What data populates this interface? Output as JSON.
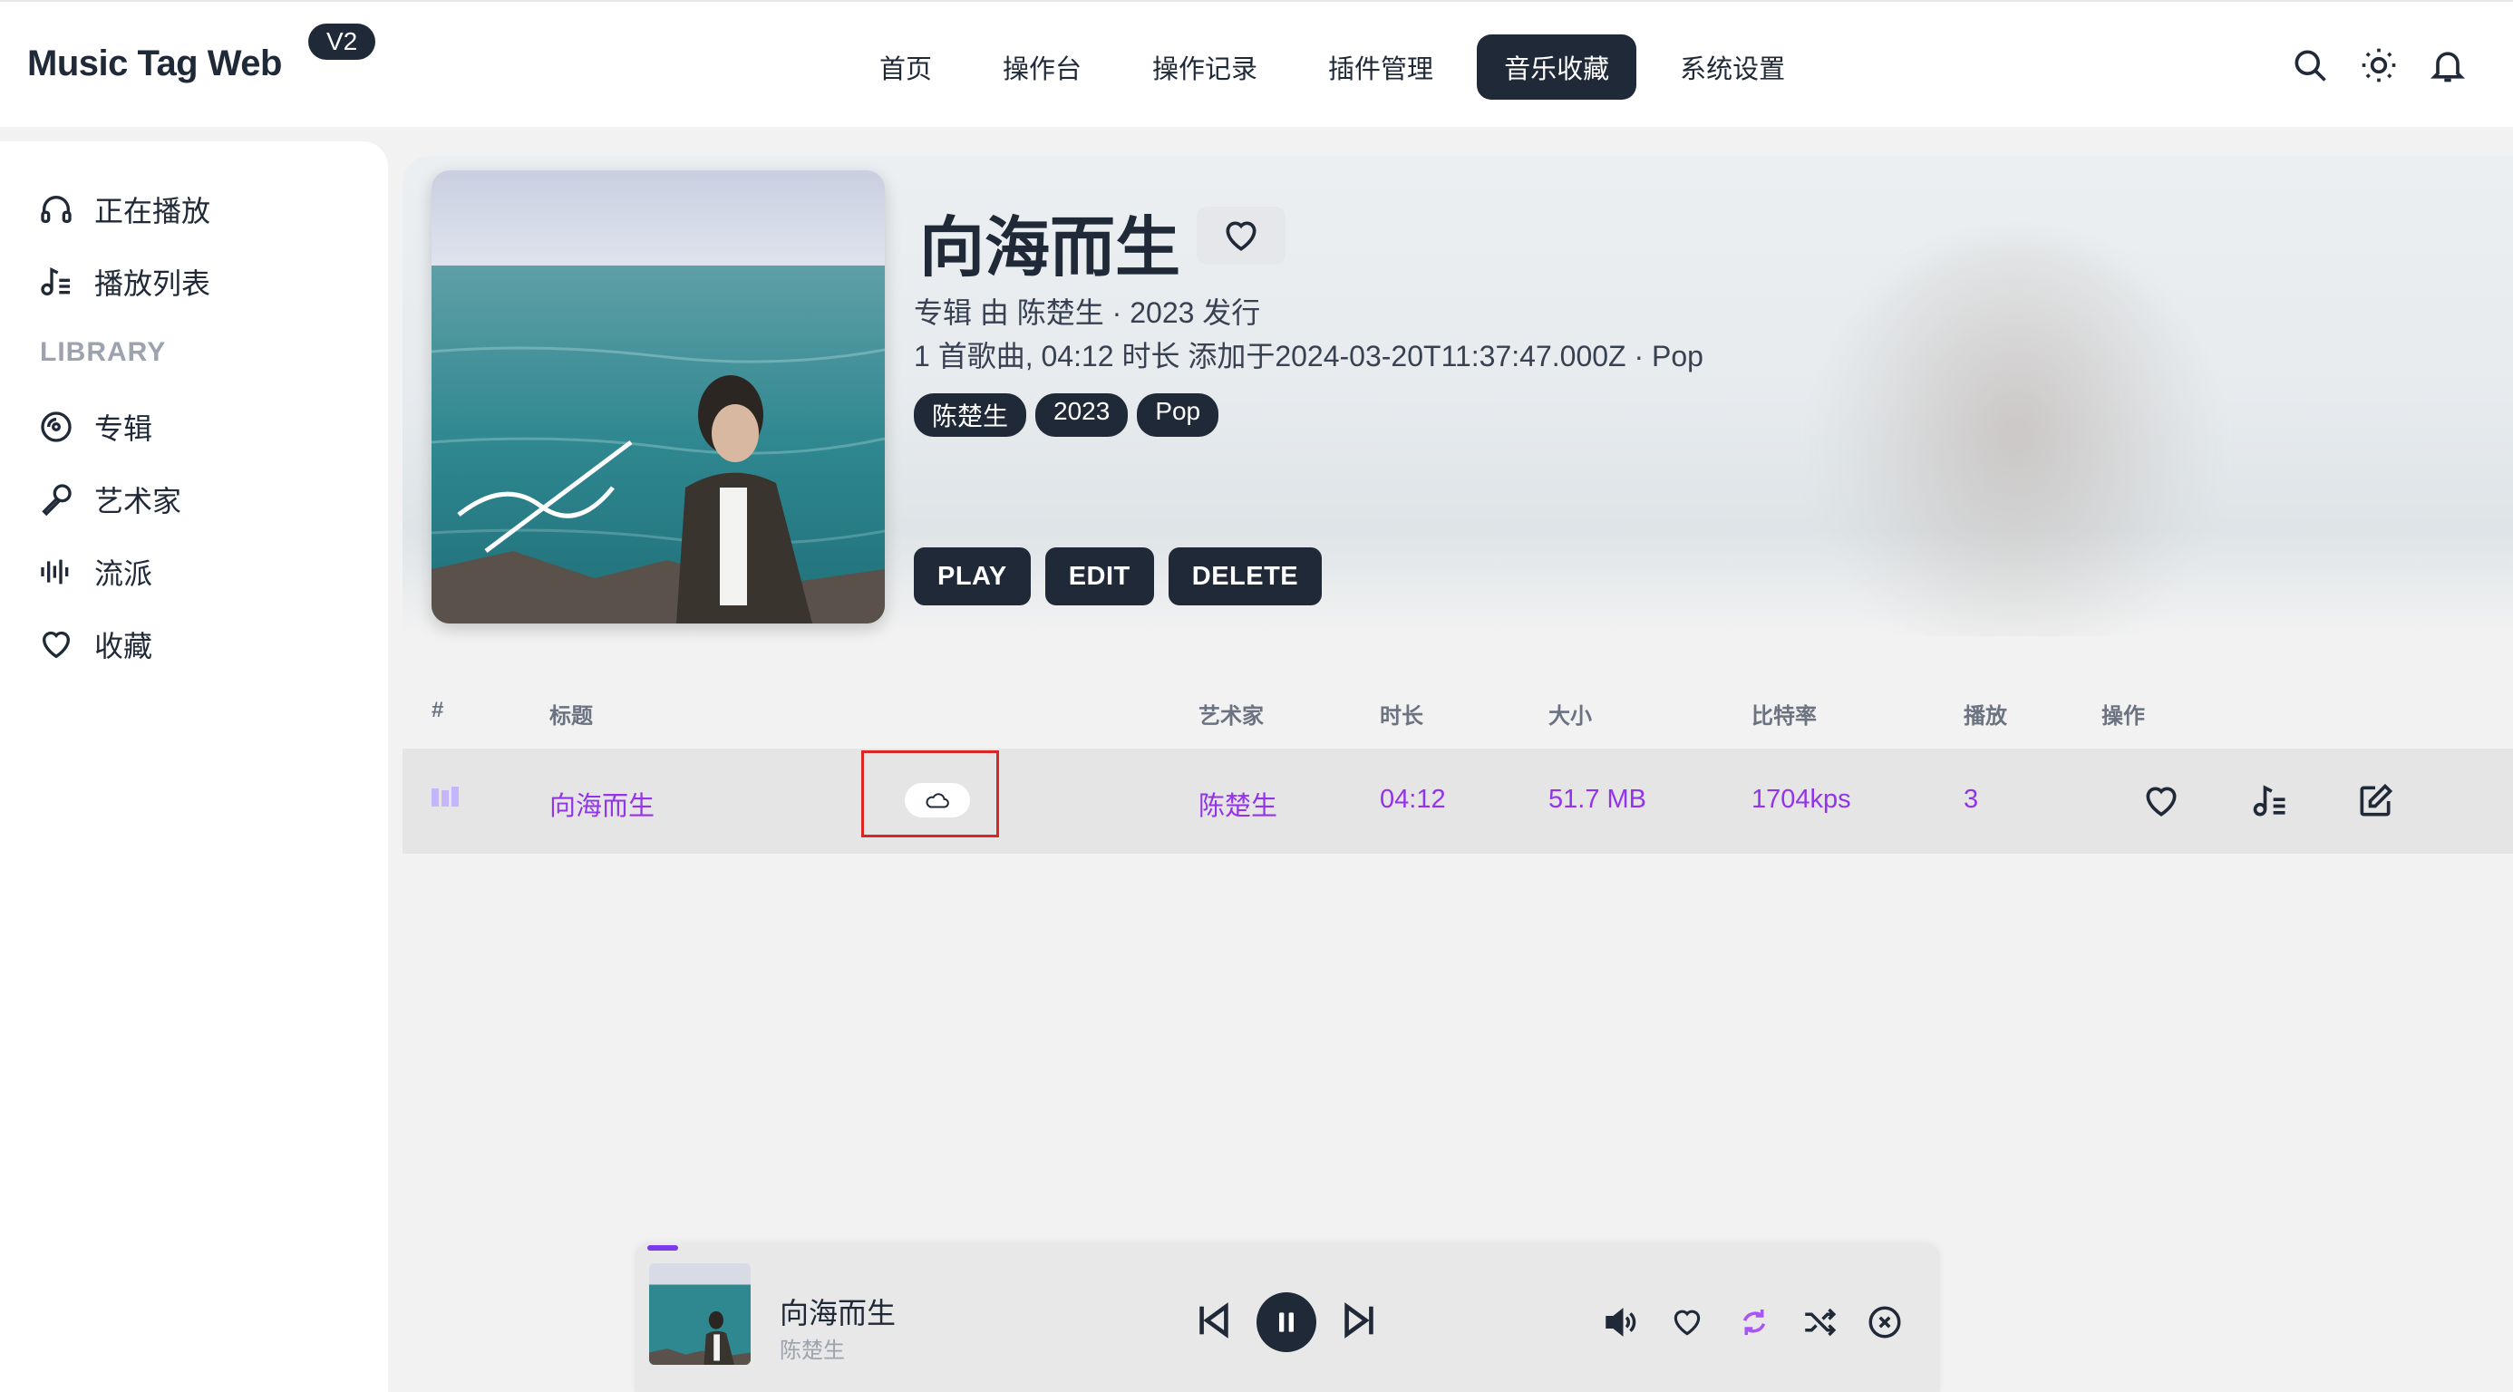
{
  "app": {
    "name": "Music Tag Web",
    "version": "V2"
  },
  "nav": [
    {
      "label": "首页"
    },
    {
      "label": "操作台"
    },
    {
      "label": "操作记录"
    },
    {
      "label": "插件管理"
    },
    {
      "label": "音乐收藏",
      "active": true
    },
    {
      "label": "系统设置"
    }
  ],
  "sidebar": {
    "items": [
      {
        "label": "正在播放",
        "icon": "headphones-icon"
      },
      {
        "label": "播放列表",
        "icon": "playlist-icon"
      }
    ],
    "section_title": "LIBRARY",
    "library": [
      {
        "label": "专辑",
        "icon": "album-icon"
      },
      {
        "label": "艺术家",
        "icon": "microphone-icon"
      },
      {
        "label": "流派",
        "icon": "genre-bars-icon"
      },
      {
        "label": "收藏",
        "icon": "heart-icon"
      }
    ]
  },
  "album": {
    "title": "向海而生",
    "meta_line1": "专辑 由 陈楚生 · 2023 发行",
    "meta_line2": "1 首歌曲, 04:12 时长 添加于2024-03-20T11:37:47.000Z · Pop",
    "tags": [
      "陈楚生",
      "2023",
      "Pop"
    ],
    "actions": {
      "play": "PLAY",
      "edit": "EDIT",
      "delete": "DELETE"
    }
  },
  "table": {
    "headers": {
      "index": "#",
      "title": "标题",
      "artist": "艺术家",
      "duration": "时长",
      "size": "大小",
      "bitrate": "比特率",
      "plays": "播放",
      "ops": "操作"
    },
    "rows": [
      {
        "title": "向海而生",
        "artist": "陈楚生",
        "duration": "04:12",
        "size": "51.7 MB",
        "bitrate": "1704kps",
        "plays": "3"
      }
    ]
  },
  "player": {
    "title": "向海而生",
    "artist": "陈楚生",
    "progress": 0.02
  },
  "colors": {
    "accent": "#9333ea",
    "dark": "#1f2937",
    "highlight": "#dc2626"
  }
}
